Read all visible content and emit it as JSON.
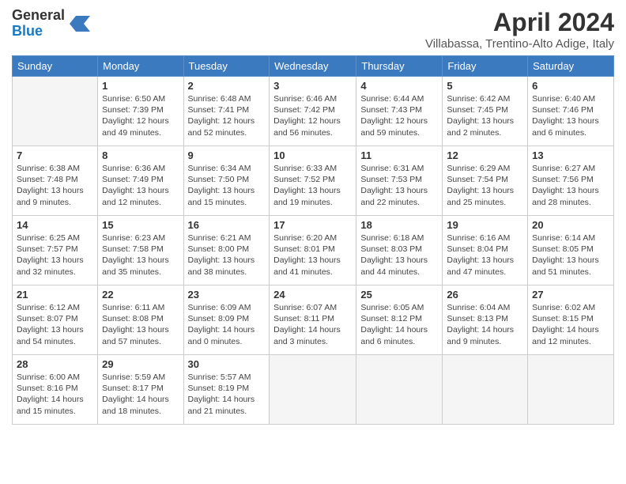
{
  "header": {
    "logo_general": "General",
    "logo_blue": "Blue",
    "title": "April 2024",
    "subtitle": "Villabassa, Trentino-Alto Adige, Italy"
  },
  "days_of_week": [
    "Sunday",
    "Monday",
    "Tuesday",
    "Wednesday",
    "Thursday",
    "Friday",
    "Saturday"
  ],
  "weeks": [
    [
      {
        "day": "",
        "info": ""
      },
      {
        "day": "1",
        "info": "Sunrise: 6:50 AM\nSunset: 7:39 PM\nDaylight: 12 hours\nand 49 minutes."
      },
      {
        "day": "2",
        "info": "Sunrise: 6:48 AM\nSunset: 7:41 PM\nDaylight: 12 hours\nand 52 minutes."
      },
      {
        "day": "3",
        "info": "Sunrise: 6:46 AM\nSunset: 7:42 PM\nDaylight: 12 hours\nand 56 minutes."
      },
      {
        "day": "4",
        "info": "Sunrise: 6:44 AM\nSunset: 7:43 PM\nDaylight: 12 hours\nand 59 minutes."
      },
      {
        "day": "5",
        "info": "Sunrise: 6:42 AM\nSunset: 7:45 PM\nDaylight: 13 hours\nand 2 minutes."
      },
      {
        "day": "6",
        "info": "Sunrise: 6:40 AM\nSunset: 7:46 PM\nDaylight: 13 hours\nand 6 minutes."
      }
    ],
    [
      {
        "day": "7",
        "info": "Sunrise: 6:38 AM\nSunset: 7:48 PM\nDaylight: 13 hours\nand 9 minutes."
      },
      {
        "day": "8",
        "info": "Sunrise: 6:36 AM\nSunset: 7:49 PM\nDaylight: 13 hours\nand 12 minutes."
      },
      {
        "day": "9",
        "info": "Sunrise: 6:34 AM\nSunset: 7:50 PM\nDaylight: 13 hours\nand 15 minutes."
      },
      {
        "day": "10",
        "info": "Sunrise: 6:33 AM\nSunset: 7:52 PM\nDaylight: 13 hours\nand 19 minutes."
      },
      {
        "day": "11",
        "info": "Sunrise: 6:31 AM\nSunset: 7:53 PM\nDaylight: 13 hours\nand 22 minutes."
      },
      {
        "day": "12",
        "info": "Sunrise: 6:29 AM\nSunset: 7:54 PM\nDaylight: 13 hours\nand 25 minutes."
      },
      {
        "day": "13",
        "info": "Sunrise: 6:27 AM\nSunset: 7:56 PM\nDaylight: 13 hours\nand 28 minutes."
      }
    ],
    [
      {
        "day": "14",
        "info": "Sunrise: 6:25 AM\nSunset: 7:57 PM\nDaylight: 13 hours\nand 32 minutes."
      },
      {
        "day": "15",
        "info": "Sunrise: 6:23 AM\nSunset: 7:58 PM\nDaylight: 13 hours\nand 35 minutes."
      },
      {
        "day": "16",
        "info": "Sunrise: 6:21 AM\nSunset: 8:00 PM\nDaylight: 13 hours\nand 38 minutes."
      },
      {
        "day": "17",
        "info": "Sunrise: 6:20 AM\nSunset: 8:01 PM\nDaylight: 13 hours\nand 41 minutes."
      },
      {
        "day": "18",
        "info": "Sunrise: 6:18 AM\nSunset: 8:03 PM\nDaylight: 13 hours\nand 44 minutes."
      },
      {
        "day": "19",
        "info": "Sunrise: 6:16 AM\nSunset: 8:04 PM\nDaylight: 13 hours\nand 47 minutes."
      },
      {
        "day": "20",
        "info": "Sunrise: 6:14 AM\nSunset: 8:05 PM\nDaylight: 13 hours\nand 51 minutes."
      }
    ],
    [
      {
        "day": "21",
        "info": "Sunrise: 6:12 AM\nSunset: 8:07 PM\nDaylight: 13 hours\nand 54 minutes."
      },
      {
        "day": "22",
        "info": "Sunrise: 6:11 AM\nSunset: 8:08 PM\nDaylight: 13 hours\nand 57 minutes."
      },
      {
        "day": "23",
        "info": "Sunrise: 6:09 AM\nSunset: 8:09 PM\nDaylight: 14 hours\nand 0 minutes."
      },
      {
        "day": "24",
        "info": "Sunrise: 6:07 AM\nSunset: 8:11 PM\nDaylight: 14 hours\nand 3 minutes."
      },
      {
        "day": "25",
        "info": "Sunrise: 6:05 AM\nSunset: 8:12 PM\nDaylight: 14 hours\nand 6 minutes."
      },
      {
        "day": "26",
        "info": "Sunrise: 6:04 AM\nSunset: 8:13 PM\nDaylight: 14 hours\nand 9 minutes."
      },
      {
        "day": "27",
        "info": "Sunrise: 6:02 AM\nSunset: 8:15 PM\nDaylight: 14 hours\nand 12 minutes."
      }
    ],
    [
      {
        "day": "28",
        "info": "Sunrise: 6:00 AM\nSunset: 8:16 PM\nDaylight: 14 hours\nand 15 minutes."
      },
      {
        "day": "29",
        "info": "Sunrise: 5:59 AM\nSunset: 8:17 PM\nDaylight: 14 hours\nand 18 minutes."
      },
      {
        "day": "30",
        "info": "Sunrise: 5:57 AM\nSunset: 8:19 PM\nDaylight: 14 hours\nand 21 minutes."
      },
      {
        "day": "",
        "info": ""
      },
      {
        "day": "",
        "info": ""
      },
      {
        "day": "",
        "info": ""
      },
      {
        "day": "",
        "info": ""
      }
    ]
  ]
}
